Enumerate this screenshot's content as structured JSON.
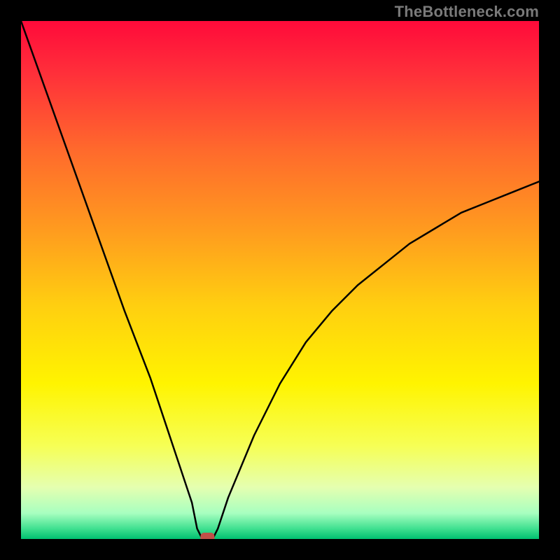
{
  "watermark": "TheBottleneck.com",
  "chart_data": {
    "type": "line",
    "title": "",
    "xlabel": "",
    "ylabel": "",
    "xlim": [
      0,
      100
    ],
    "ylim": [
      0,
      100
    ],
    "series": [
      {
        "name": "bottleneck-curve",
        "x": [
          0,
          5,
          10,
          15,
          20,
          25,
          28,
          30,
          32,
          33,
          34,
          35,
          36,
          37,
          38,
          40,
          45,
          50,
          55,
          60,
          65,
          70,
          75,
          80,
          85,
          90,
          95,
          100
        ],
        "values": [
          100,
          86,
          72,
          58,
          44,
          31,
          22,
          16,
          10,
          7,
          2,
          0,
          0,
          0,
          2,
          8,
          20,
          30,
          38,
          44,
          49,
          53,
          57,
          60,
          63,
          65,
          67,
          69
        ]
      }
    ],
    "marker": {
      "x": 36,
      "y": 0
    },
    "gradient_stops": [
      {
        "offset": 0.0,
        "color": "#ff0a3a"
      },
      {
        "offset": 0.1,
        "color": "#ff2f3a"
      },
      {
        "offset": 0.25,
        "color": "#ff6a2c"
      },
      {
        "offset": 0.4,
        "color": "#ff9a1f"
      },
      {
        "offset": 0.55,
        "color": "#ffcf10"
      },
      {
        "offset": 0.7,
        "color": "#fff400"
      },
      {
        "offset": 0.82,
        "color": "#f6ff55"
      },
      {
        "offset": 0.9,
        "color": "#e5ffb0"
      },
      {
        "offset": 0.95,
        "color": "#a8ffc0"
      },
      {
        "offset": 0.98,
        "color": "#40e090"
      },
      {
        "offset": 1.0,
        "color": "#00c070"
      }
    ]
  }
}
